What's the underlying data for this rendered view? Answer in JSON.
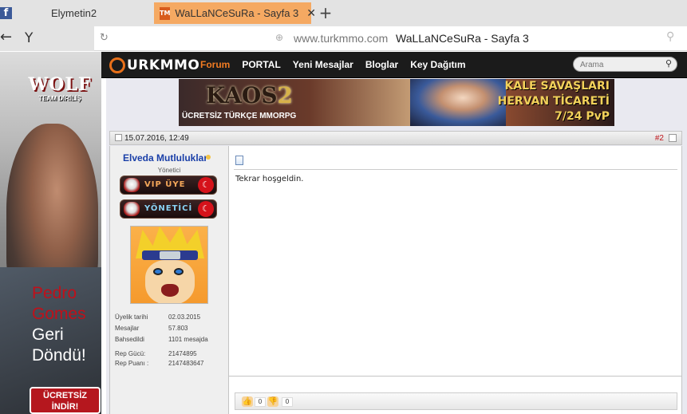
{
  "browser": {
    "tabs": [
      {
        "label": "Elymetin2",
        "favicon": "facebook-icon"
      },
      {
        "label": "WaLLaNCeSuRa - Sayfa 3",
        "favicon": "turkmmo-icon",
        "active": true
      }
    ],
    "new_tab_glyph": "+",
    "close_glyph": "✕",
    "url_domain": "www.turkmmo.com",
    "url_title": "WaLLaNCeSuRa - Sayfa 3",
    "accent_color": "#f5a962"
  },
  "side_ad": {
    "logo_main": "WOLF",
    "logo_sub": "TEAM DİRİLİŞ",
    "line1": "Pedro",
    "line2": "Gomes",
    "line3": "Geri",
    "line4": "Döndü!",
    "cta_line1": "ÜCRETSİZ",
    "cta_line2": "İNDİR!"
  },
  "site_nav": {
    "brand": "URKMMO",
    "links": [
      "Forum",
      "PORTAL",
      "Yeni Mesajlar",
      "Bloglar",
      "Key Dağıtım"
    ],
    "active_link": "Forum",
    "search_placeholder": "Arama",
    "active_color": "#f07b22"
  },
  "banner": {
    "game": "KAOS",
    "game_num": "2",
    "tagline": "ÜCRETSİZ TÜRKÇE MMORPG",
    "right_line1": "KALE SAVAŞLARI",
    "right_line2": "HERVAN TİCARETİ",
    "right_line3": "7/24 PvP"
  },
  "post": {
    "date": "15.07.2016, 12:49",
    "number": "#2",
    "username": "Elveda Mutluluklar",
    "rank": "Yönetici",
    "badge_vip": "VIP ÜYE",
    "badge_yonetici": "YÖNETİCİ",
    "stats": [
      {
        "key": "Üyelik tarihi",
        "value": "02.03.2015"
      },
      {
        "key": "Mesajlar",
        "value": "57.803"
      },
      {
        "key": "Bahsedildi",
        "value": "1101 mesajda"
      },
      {
        "key": "Rep Gücü:",
        "value": "21474895"
      },
      {
        "key": "Rep Puanı :",
        "value": "2147483647"
      }
    ],
    "message": "Tekrar hoşgeldin.",
    "likes": "0",
    "dislikes": "0",
    "username_color": "#1a3fa8",
    "number_color": "#c0141a"
  }
}
